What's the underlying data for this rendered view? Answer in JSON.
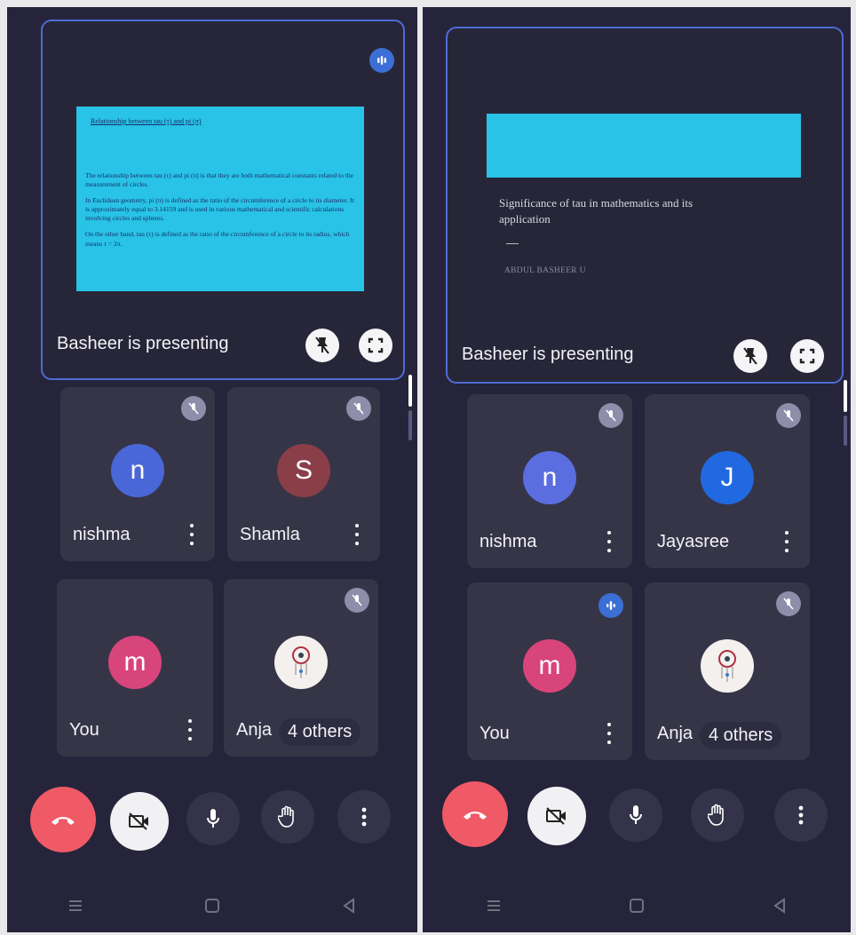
{
  "left": {
    "slide": {
      "title": "Relationship between tau (τ) and pi (π)",
      "paragraphs": [
        "The relationship between tau (τ) and pi (π) is that they are both mathematical constants related to the measurement of circles.",
        "In Euclidean geometry, pi (π) is defined as the ratio of the circumference of a circle to its diameter. It is approximately equal to 3.14159 and is used in various mathematical and scientific calculations involving circles and spheres.",
        "On the other hand, tau (τ) is defined as the ratio of the circumference of a circle to its radius, which means τ = 2π."
      ]
    },
    "presenting_label": "Basheer is presenting",
    "participants": [
      {
        "name": "nishma",
        "initial": "n",
        "color": "#4a67d8"
      },
      {
        "name": "Shamla",
        "initial": "S",
        "color": "#8a3e48"
      },
      {
        "name": "You",
        "initial": "m",
        "color": "#d8457a"
      },
      {
        "name": "Anja",
        "initial": "",
        "color": "#f4f0ee"
      }
    ],
    "others_label": "4 others"
  },
  "right": {
    "slide": {
      "subtitle": "Significance of tau in mathematics and its application",
      "author": "ABDUL BASHEER U"
    },
    "presenting_label": "Basheer is presenting",
    "participants": [
      {
        "name": "nishma",
        "initial": "n",
        "color": "#5a6ee0"
      },
      {
        "name": "Jayasree",
        "initial": "J",
        "color": "#2169e0"
      },
      {
        "name": "You",
        "initial": "m",
        "color": "#d8457a"
      },
      {
        "name": "Anja",
        "initial": "",
        "color": "#f4f0ee"
      }
    ],
    "others_label": "4 others"
  },
  "controls": [
    "end-call",
    "camera-off",
    "microphone",
    "raise-hand",
    "more-options"
  ],
  "icons": {
    "audio": "audio-wave-icon",
    "muted": "mic-off-icon",
    "unpin": "unpin-icon",
    "fullscreen": "fullscreen-icon"
  }
}
